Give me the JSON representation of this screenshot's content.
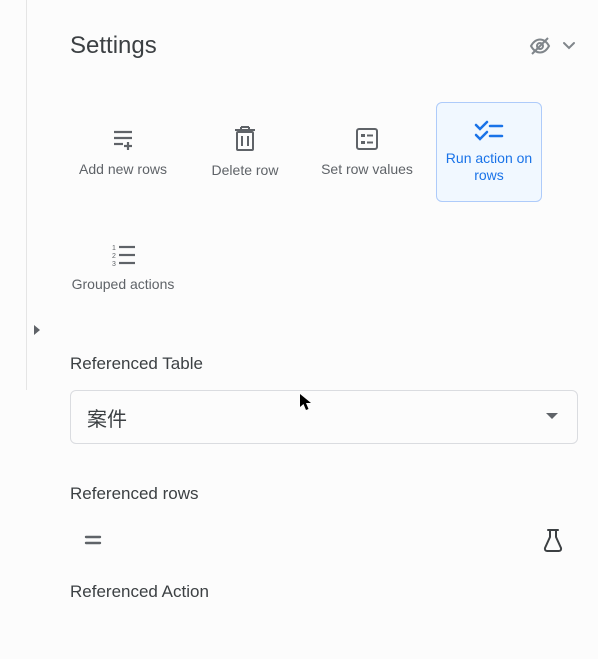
{
  "header": {
    "title": "Settings"
  },
  "tiles": {
    "add_new_rows": "Add new rows",
    "delete_row": "Delete row",
    "set_row_values": "Set row values",
    "run_action_on_rows": "Run action on rows",
    "grouped_actions": "Grouped actions"
  },
  "sections": {
    "referenced_table": "Referenced Table",
    "referenced_rows": "Referenced rows",
    "referenced_action": "Referenced Action"
  },
  "select": {
    "referenced_table_value": "案件"
  }
}
